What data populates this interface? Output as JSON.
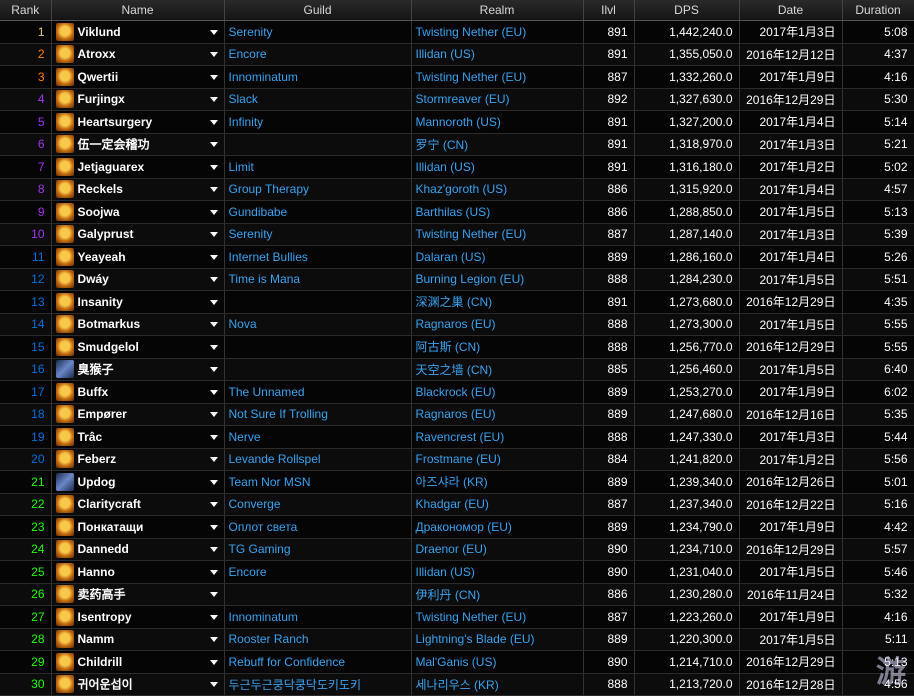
{
  "columns": {
    "rank": "Rank",
    "name": "Name",
    "guild": "Guild",
    "realm": "Realm",
    "ilvl": "Ilvl",
    "dps": "DPS",
    "date": "Date",
    "duration": "Duration"
  },
  "rows": [
    {
      "rank": "1",
      "tier": "gold",
      "icon": "warlock-icon",
      "name": "Viklund",
      "guild": "Serenity",
      "realm": "Twisting Nether (EU)",
      "ilvl": "891",
      "dps": "1,442,240.0",
      "date": "2017年1月3日",
      "duration": "5:08"
    },
    {
      "rank": "2",
      "tier": "orange",
      "icon": "warlock-icon",
      "name": "Atroxx",
      "guild": "Encore",
      "realm": "Illidan (US)",
      "ilvl": "891",
      "dps": "1,355,050.0",
      "date": "2016年12月12日",
      "duration": "4:37"
    },
    {
      "rank": "3",
      "tier": "orange",
      "icon": "warlock-icon",
      "name": "Qwertii",
      "guild": "Innominatum",
      "realm": "Twisting Nether (EU)",
      "ilvl": "887",
      "dps": "1,332,260.0",
      "date": "2017年1月9日",
      "duration": "4:16"
    },
    {
      "rank": "4",
      "tier": "purple",
      "icon": "warlock-icon",
      "name": "Furjingx",
      "guild": "Slack",
      "realm": "Stormreaver (EU)",
      "ilvl": "892",
      "dps": "1,327,630.0",
      "date": "2016年12月29日",
      "duration": "5:30"
    },
    {
      "rank": "5",
      "tier": "purple",
      "icon": "warlock-icon",
      "name": "Heartsurgery",
      "guild": "Infinity",
      "realm": "Mannoroth (US)",
      "ilvl": "891",
      "dps": "1,327,200.0",
      "date": "2017年1月4日",
      "duration": "5:14"
    },
    {
      "rank": "6",
      "tier": "purple",
      "icon": "warlock-icon",
      "name": "伍一定会稽功",
      "guild": "",
      "realm": "罗宁 (CN)",
      "ilvl": "891",
      "dps": "1,318,970.0",
      "date": "2017年1月3日",
      "duration": "5:21"
    },
    {
      "rank": "7",
      "tier": "purple",
      "icon": "warlock-icon",
      "name": "Jetjaguarex",
      "guild": "Limit",
      "realm": "Illidan (US)",
      "ilvl": "891",
      "dps": "1,316,180.0",
      "date": "2017年1月2日",
      "duration": "5:02"
    },
    {
      "rank": "8",
      "tier": "purple",
      "icon": "warlock-icon",
      "name": "Reckels",
      "guild": "Group Therapy",
      "realm": "Khaz'goroth (US)",
      "ilvl": "886",
      "dps": "1,315,920.0",
      "date": "2017年1月4日",
      "duration": "4:57"
    },
    {
      "rank": "9",
      "tier": "purple",
      "icon": "warlock-icon",
      "name": "Soojwa",
      "guild": "Gundibabe",
      "realm": "Barthilas (US)",
      "ilvl": "886",
      "dps": "1,288,850.0",
      "date": "2017年1月5日",
      "duration": "5:13"
    },
    {
      "rank": "10",
      "tier": "purple",
      "icon": "warlock-icon",
      "name": "Galyprust",
      "guild": "Serenity",
      "realm": "Twisting Nether (EU)",
      "ilvl": "887",
      "dps": "1,287,140.0",
      "date": "2017年1月3日",
      "duration": "5:39"
    },
    {
      "rank": "11",
      "tier": "blue",
      "icon": "warlock-icon",
      "name": "Yeayeah",
      "guild": "Internet Bullies",
      "realm": "Dalaran (US)",
      "ilvl": "889",
      "dps": "1,286,160.0",
      "date": "2017年1月4日",
      "duration": "5:26"
    },
    {
      "rank": "12",
      "tier": "blue",
      "icon": "warlock-icon",
      "name": "Dwáy",
      "guild": "Time is Mana",
      "realm": "Burning Legion (EU)",
      "ilvl": "888",
      "dps": "1,284,230.0",
      "date": "2017年1月5日",
      "duration": "5:51"
    },
    {
      "rank": "13",
      "tier": "blue",
      "icon": "warlock-icon",
      "name": "Insanity",
      "guild": "",
      "realm": "深渊之巢 (CN)",
      "ilvl": "891",
      "dps": "1,273,680.0",
      "date": "2016年12月29日",
      "duration": "4:35"
    },
    {
      "rank": "14",
      "tier": "blue",
      "icon": "warlock-icon",
      "name": "Botmarkus",
      "guild": "Nova",
      "realm": "Ragnaros (EU)",
      "ilvl": "888",
      "dps": "1,273,300.0",
      "date": "2017年1月5日",
      "duration": "5:55"
    },
    {
      "rank": "15",
      "tier": "blue",
      "icon": "warlock-icon",
      "name": "Smudgelol",
      "guild": "",
      "realm": "阿古斯 (CN)",
      "ilvl": "888",
      "dps": "1,256,770.0",
      "date": "2016年12月29日",
      "duration": "5:55"
    },
    {
      "rank": "16",
      "tier": "blue",
      "icon": "hunter-icon",
      "name": "臭猴子",
      "guild": "",
      "realm": "天空之墙 (CN)",
      "ilvl": "885",
      "dps": "1,256,460.0",
      "date": "2017年1月5日",
      "duration": "6:40"
    },
    {
      "rank": "17",
      "tier": "blue",
      "icon": "warlock-icon",
      "name": "Buffx",
      "guild": "The Unnamed",
      "realm": "Blackrock (EU)",
      "ilvl": "889",
      "dps": "1,253,270.0",
      "date": "2017年1月9日",
      "duration": "6:02"
    },
    {
      "rank": "18",
      "tier": "blue",
      "icon": "warlock-icon",
      "name": "Empører",
      "guild": "Not Sure If Trolling",
      "realm": "Ragnaros (EU)",
      "ilvl": "889",
      "dps": "1,247,680.0",
      "date": "2016年12月16日",
      "duration": "5:35"
    },
    {
      "rank": "19",
      "tier": "blue",
      "icon": "warlock-icon",
      "name": "Trâc",
      "guild": "Nerve",
      "realm": "Ravencrest (EU)",
      "ilvl": "888",
      "dps": "1,247,330.0",
      "date": "2017年1月3日",
      "duration": "5:44"
    },
    {
      "rank": "20",
      "tier": "blue",
      "icon": "warlock-icon",
      "name": "Feberz",
      "guild": "Levande Rollspel",
      "realm": "Frostmane (EU)",
      "ilvl": "884",
      "dps": "1,241,820.0",
      "date": "2017年1月2日",
      "duration": "5:56"
    },
    {
      "rank": "21",
      "tier": "green",
      "icon": "hunter-icon",
      "name": "Updog",
      "guild": "Team Nor MSN",
      "realm": "아즈샤라 (KR)",
      "ilvl": "889",
      "dps": "1,239,340.0",
      "date": "2016年12月26日",
      "duration": "5:01"
    },
    {
      "rank": "22",
      "tier": "green",
      "icon": "warlock-icon",
      "name": "Claritycraft",
      "guild": "Converge",
      "realm": "Khadgar (EU)",
      "ilvl": "887",
      "dps": "1,237,340.0",
      "date": "2016年12月22日",
      "duration": "5:16"
    },
    {
      "rank": "23",
      "tier": "green",
      "icon": "warlock-icon",
      "name": "Понкатащи",
      "guild": "Оплот света",
      "realm": "Дракономор (EU)",
      "ilvl": "889",
      "dps": "1,234,790.0",
      "date": "2017年1月9日",
      "duration": "4:42"
    },
    {
      "rank": "24",
      "tier": "green",
      "icon": "warlock-icon",
      "name": "Dannedd",
      "guild": "TG Gaming",
      "realm": "Draenor (EU)",
      "ilvl": "890",
      "dps": "1,234,710.0",
      "date": "2016年12月29日",
      "duration": "5:57"
    },
    {
      "rank": "25",
      "tier": "green",
      "icon": "warlock-icon",
      "name": "Hanno",
      "guild": "Encore",
      "realm": "Illidan (US)",
      "ilvl": "890",
      "dps": "1,231,040.0",
      "date": "2017年1月5日",
      "duration": "5:46"
    },
    {
      "rank": "26",
      "tier": "green",
      "icon": "warlock-icon",
      "name": "卖药高手",
      "guild": "",
      "realm": "伊利丹 (CN)",
      "ilvl": "886",
      "dps": "1,230,280.0",
      "date": "2016年11月24日",
      "duration": "5:32"
    },
    {
      "rank": "27",
      "tier": "green",
      "icon": "warlock-icon",
      "name": "Isentropy",
      "guild": "Innominatum",
      "realm": "Twisting Nether (EU)",
      "ilvl": "887",
      "dps": "1,223,260.0",
      "date": "2017年1月9日",
      "duration": "4:16"
    },
    {
      "rank": "28",
      "tier": "green",
      "icon": "warlock-icon",
      "name": "Namm",
      "guild": "Rooster Ranch",
      "realm": "Lightning's Blade (EU)",
      "ilvl": "889",
      "dps": "1,220,300.0",
      "date": "2017年1月5日",
      "duration": "5:11"
    },
    {
      "rank": "29",
      "tier": "green",
      "icon": "warlock-icon",
      "name": "Childrill",
      "guild": "Rebuff for Confidence",
      "realm": "Mal'Ganis (US)",
      "ilvl": "890",
      "dps": "1,214,710.0",
      "date": "2016年12月29日",
      "duration": "5:13"
    },
    {
      "rank": "30",
      "tier": "green",
      "icon": "warlock-icon",
      "name": "귀어운섭이",
      "guild": "두근두근쿵닥쿵닥도키도키",
      "realm": "세나리우스 (KR)",
      "ilvl": "888",
      "dps": "1,213,720.0",
      "date": "2016年12月28日",
      "duration": "4:56"
    }
  ],
  "watermark": "游"
}
